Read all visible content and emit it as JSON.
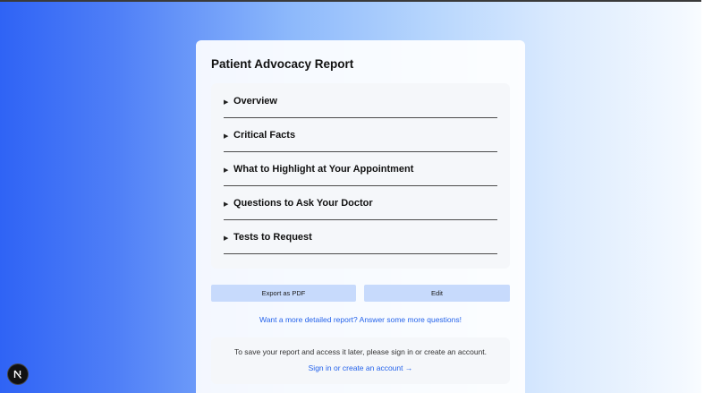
{
  "report": {
    "title": "Patient Advocacy Report",
    "sections": [
      {
        "label": "Overview",
        "arrow": "▶"
      },
      {
        "label": "Critical Facts",
        "arrow": "▶"
      },
      {
        "label": "What to Highlight at Your Appointment",
        "arrow": "▶"
      },
      {
        "label": "Questions to Ask Your Doctor",
        "arrow": "▶"
      },
      {
        "label": "Tests to Request",
        "arrow": "▶"
      }
    ]
  },
  "actions": {
    "export_label": "Export as PDF",
    "edit_label": "Edit"
  },
  "more_questions_link": "Want a more detailed report? Answer some more questions!",
  "signin": {
    "message": "To save your report and access it later, please sign in or create an account.",
    "link": "Sign in or create an account →"
  },
  "badge": {
    "icon": "nextjs-logo-icon"
  },
  "colors": {
    "accent": "#2563eb",
    "button_bg": "#c7dafc",
    "gradient_start": "#2f63f5",
    "gradient_end": "#ffffff"
  }
}
